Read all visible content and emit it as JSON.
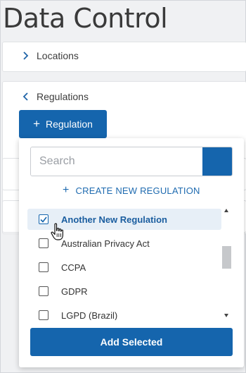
{
  "page": {
    "title": "Data Control"
  },
  "sections": {
    "locations": {
      "label": "Locations",
      "expanded": false
    },
    "regulations": {
      "label": "Regulations",
      "expanded": true,
      "add_button_label": "Regulation"
    }
  },
  "dropdown": {
    "search": {
      "placeholder": "Search",
      "value": ""
    },
    "create_link_label": "CREATE NEW REGULATION",
    "items": [
      {
        "label": "Another New Regulation",
        "checked": true
      },
      {
        "label": "Australian Privacy Act",
        "checked": false
      },
      {
        "label": "CCPA",
        "checked": false
      },
      {
        "label": "GDPR",
        "checked": false
      },
      {
        "label": "LGPD (Brazil)",
        "checked": false
      }
    ],
    "add_selected_label": "Add Selected"
  },
  "colors": {
    "accent": "#1565ad",
    "link": "#1f6bb0",
    "selected_row_bg": "#e7eff7",
    "page_bg": "#f0f1f3"
  }
}
